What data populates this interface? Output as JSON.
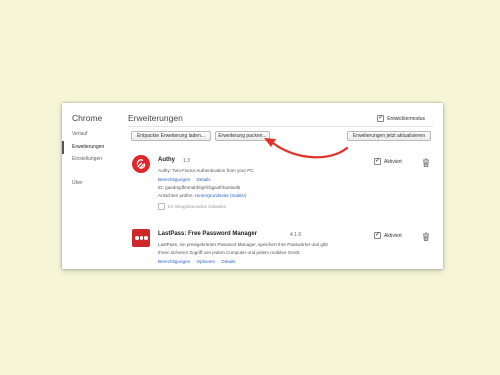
{
  "sidebar": {
    "title": "Chrome",
    "items": [
      {
        "label": "Verlauf",
        "active": false
      },
      {
        "label": "Erweiterungen",
        "active": true
      },
      {
        "label": "Einstellungen",
        "active": false
      },
      {
        "label": "Über",
        "active": false
      }
    ]
  },
  "header": {
    "title": "Erweiterungen",
    "devmode_label": "Entwicklermodus",
    "devmode_checked": true
  },
  "toolbar": {
    "load_unpacked": "Entpackte Erweiterung laden...",
    "pack_extension": "Erweiterung packen...",
    "update_now": "Erweiterungen jetzt aktualisieren"
  },
  "extensions": [
    {
      "name": "Authy",
      "version": "1.3",
      "description": "Authy: Two-Factor Authentication from your PC",
      "permissions_link": "Berechtigungen",
      "details_link": "Details",
      "id_line": "ID: gaedmjdfmmahhbjefcbgaolhhanlaolb",
      "inspect_label": "Ansichten prüfen:",
      "inspect_link": "Hintergrundseite (Inaktiv)",
      "incognito_label": "Im Inkognitomodus zulassen",
      "enabled_label": "Aktiviert",
      "icon": "authy-icon",
      "color": "#e0252c"
    },
    {
      "name": "LastPass: Free Password Manager",
      "version": "4.1.6",
      "description_line1": "LastPass, ein preisgekrönter Passwort Manager, speichert Ihre Passwörter und gibt",
      "description_line2": "Ihnen sicheren Zugriff von jedem Computer und jedem mobilen Gerät.",
      "permissions_link": "Berechtigungen",
      "options_link": "Optionen",
      "details_link": "Details",
      "enabled_label": "Aktiviert",
      "icon": "lastpass-icon",
      "color": "#cc2a2a"
    }
  ],
  "colors": {
    "background": "#f6f6d7",
    "link": "#2a66c6",
    "annotation_arrow": "#e3322a"
  }
}
